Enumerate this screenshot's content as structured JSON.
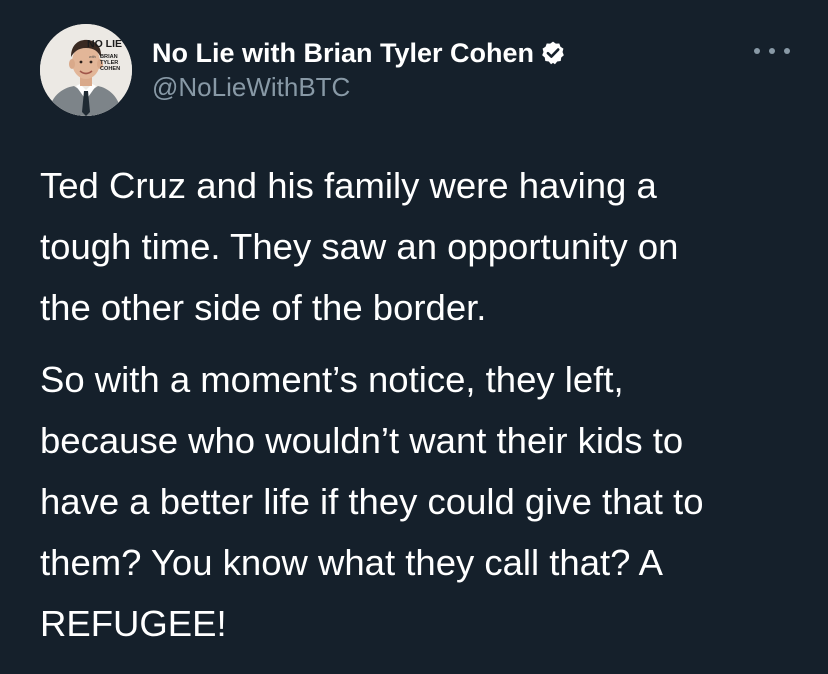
{
  "author": {
    "name": "No Lie with Brian Tyler Cohen",
    "handle": "@NoLieWithBTC",
    "verified": true,
    "avatar_logo_text": [
      "NO LIE",
      "with",
      "BRIAN",
      "TYLER",
      "COHEN"
    ]
  },
  "icons": {
    "verified": "verified-badge-icon",
    "more": "more-options-icon"
  },
  "colors": {
    "background": "#15202b",
    "text": "#ffffff",
    "secondary_text": "#8899a6"
  },
  "tweet": {
    "paragraphs": [
      {
        "lines": [
          "Ted Cruz and his family were having a",
          "tough time. They saw an opportunity on",
          "the other side of the border."
        ]
      },
      {
        "lines": [
          "So with a moment’s notice, they left,",
          "because who wouldn’t want their kids to",
          "have a better life if they could give that to",
          "them? You know what they call that? A",
          "REFUGEE!"
        ]
      }
    ]
  }
}
